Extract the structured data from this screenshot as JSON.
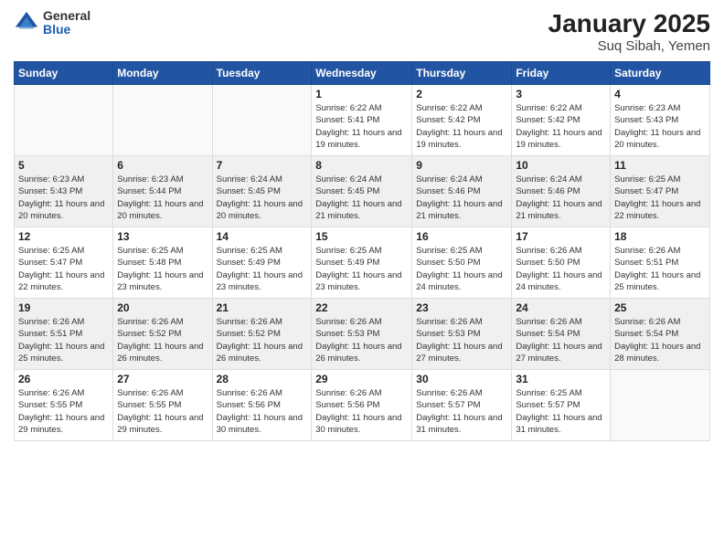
{
  "logo": {
    "general": "General",
    "blue": "Blue"
  },
  "title": "January 2025",
  "subtitle": "Suq Sibah, Yemen",
  "weekdays": [
    "Sunday",
    "Monday",
    "Tuesday",
    "Wednesday",
    "Thursday",
    "Friday",
    "Saturday"
  ],
  "weeks": [
    [
      {
        "day": "",
        "sunrise": "",
        "sunset": "",
        "daylight": ""
      },
      {
        "day": "",
        "sunrise": "",
        "sunset": "",
        "daylight": ""
      },
      {
        "day": "",
        "sunrise": "",
        "sunset": "",
        "daylight": ""
      },
      {
        "day": "1",
        "sunrise": "Sunrise: 6:22 AM",
        "sunset": "Sunset: 5:41 PM",
        "daylight": "Daylight: 11 hours and 19 minutes."
      },
      {
        "day": "2",
        "sunrise": "Sunrise: 6:22 AM",
        "sunset": "Sunset: 5:42 PM",
        "daylight": "Daylight: 11 hours and 19 minutes."
      },
      {
        "day": "3",
        "sunrise": "Sunrise: 6:22 AM",
        "sunset": "Sunset: 5:42 PM",
        "daylight": "Daylight: 11 hours and 19 minutes."
      },
      {
        "day": "4",
        "sunrise": "Sunrise: 6:23 AM",
        "sunset": "Sunset: 5:43 PM",
        "daylight": "Daylight: 11 hours and 20 minutes."
      }
    ],
    [
      {
        "day": "5",
        "sunrise": "Sunrise: 6:23 AM",
        "sunset": "Sunset: 5:43 PM",
        "daylight": "Daylight: 11 hours and 20 minutes."
      },
      {
        "day": "6",
        "sunrise": "Sunrise: 6:23 AM",
        "sunset": "Sunset: 5:44 PM",
        "daylight": "Daylight: 11 hours and 20 minutes."
      },
      {
        "day": "7",
        "sunrise": "Sunrise: 6:24 AM",
        "sunset": "Sunset: 5:45 PM",
        "daylight": "Daylight: 11 hours and 20 minutes."
      },
      {
        "day": "8",
        "sunrise": "Sunrise: 6:24 AM",
        "sunset": "Sunset: 5:45 PM",
        "daylight": "Daylight: 11 hours and 21 minutes."
      },
      {
        "day": "9",
        "sunrise": "Sunrise: 6:24 AM",
        "sunset": "Sunset: 5:46 PM",
        "daylight": "Daylight: 11 hours and 21 minutes."
      },
      {
        "day": "10",
        "sunrise": "Sunrise: 6:24 AM",
        "sunset": "Sunset: 5:46 PM",
        "daylight": "Daylight: 11 hours and 21 minutes."
      },
      {
        "day": "11",
        "sunrise": "Sunrise: 6:25 AM",
        "sunset": "Sunset: 5:47 PM",
        "daylight": "Daylight: 11 hours and 22 minutes."
      }
    ],
    [
      {
        "day": "12",
        "sunrise": "Sunrise: 6:25 AM",
        "sunset": "Sunset: 5:47 PM",
        "daylight": "Daylight: 11 hours and 22 minutes."
      },
      {
        "day": "13",
        "sunrise": "Sunrise: 6:25 AM",
        "sunset": "Sunset: 5:48 PM",
        "daylight": "Daylight: 11 hours and 23 minutes."
      },
      {
        "day": "14",
        "sunrise": "Sunrise: 6:25 AM",
        "sunset": "Sunset: 5:49 PM",
        "daylight": "Daylight: 11 hours and 23 minutes."
      },
      {
        "day": "15",
        "sunrise": "Sunrise: 6:25 AM",
        "sunset": "Sunset: 5:49 PM",
        "daylight": "Daylight: 11 hours and 23 minutes."
      },
      {
        "day": "16",
        "sunrise": "Sunrise: 6:25 AM",
        "sunset": "Sunset: 5:50 PM",
        "daylight": "Daylight: 11 hours and 24 minutes."
      },
      {
        "day": "17",
        "sunrise": "Sunrise: 6:26 AM",
        "sunset": "Sunset: 5:50 PM",
        "daylight": "Daylight: 11 hours and 24 minutes."
      },
      {
        "day": "18",
        "sunrise": "Sunrise: 6:26 AM",
        "sunset": "Sunset: 5:51 PM",
        "daylight": "Daylight: 11 hours and 25 minutes."
      }
    ],
    [
      {
        "day": "19",
        "sunrise": "Sunrise: 6:26 AM",
        "sunset": "Sunset: 5:51 PM",
        "daylight": "Daylight: 11 hours and 25 minutes."
      },
      {
        "day": "20",
        "sunrise": "Sunrise: 6:26 AM",
        "sunset": "Sunset: 5:52 PM",
        "daylight": "Daylight: 11 hours and 26 minutes."
      },
      {
        "day": "21",
        "sunrise": "Sunrise: 6:26 AM",
        "sunset": "Sunset: 5:52 PM",
        "daylight": "Daylight: 11 hours and 26 minutes."
      },
      {
        "day": "22",
        "sunrise": "Sunrise: 6:26 AM",
        "sunset": "Sunset: 5:53 PM",
        "daylight": "Daylight: 11 hours and 26 minutes."
      },
      {
        "day": "23",
        "sunrise": "Sunrise: 6:26 AM",
        "sunset": "Sunset: 5:53 PM",
        "daylight": "Daylight: 11 hours and 27 minutes."
      },
      {
        "day": "24",
        "sunrise": "Sunrise: 6:26 AM",
        "sunset": "Sunset: 5:54 PM",
        "daylight": "Daylight: 11 hours and 27 minutes."
      },
      {
        "day": "25",
        "sunrise": "Sunrise: 6:26 AM",
        "sunset": "Sunset: 5:54 PM",
        "daylight": "Daylight: 11 hours and 28 minutes."
      }
    ],
    [
      {
        "day": "26",
        "sunrise": "Sunrise: 6:26 AM",
        "sunset": "Sunset: 5:55 PM",
        "daylight": "Daylight: 11 hours and 29 minutes."
      },
      {
        "day": "27",
        "sunrise": "Sunrise: 6:26 AM",
        "sunset": "Sunset: 5:55 PM",
        "daylight": "Daylight: 11 hours and 29 minutes."
      },
      {
        "day": "28",
        "sunrise": "Sunrise: 6:26 AM",
        "sunset": "Sunset: 5:56 PM",
        "daylight": "Daylight: 11 hours and 30 minutes."
      },
      {
        "day": "29",
        "sunrise": "Sunrise: 6:26 AM",
        "sunset": "Sunset: 5:56 PM",
        "daylight": "Daylight: 11 hours and 30 minutes."
      },
      {
        "day": "30",
        "sunrise": "Sunrise: 6:26 AM",
        "sunset": "Sunset: 5:57 PM",
        "daylight": "Daylight: 11 hours and 31 minutes."
      },
      {
        "day": "31",
        "sunrise": "Sunrise: 6:25 AM",
        "sunset": "Sunset: 5:57 PM",
        "daylight": "Daylight: 11 hours and 31 minutes."
      },
      {
        "day": "",
        "sunrise": "",
        "sunset": "",
        "daylight": ""
      }
    ]
  ]
}
